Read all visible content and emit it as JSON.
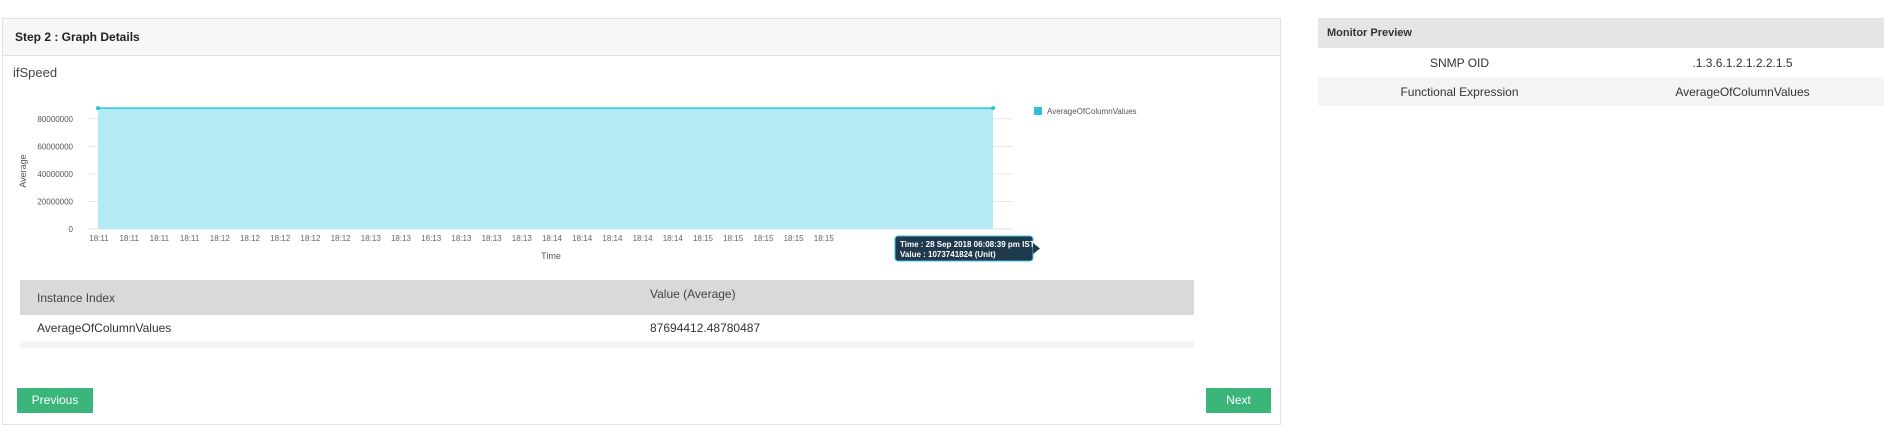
{
  "panel": {
    "title": "Step 2 : Graph Details"
  },
  "chart_data": {
    "type": "area",
    "title": "ifSpeed",
    "xlabel": "Time",
    "ylabel": "Average",
    "ylim": [
      0,
      90000000
    ],
    "yticks": [
      0,
      20000000,
      40000000,
      60000000,
      80000000
    ],
    "ytick_labels": [
      "0",
      "20000000",
      "40000000",
      "60000000",
      "80000000"
    ],
    "xtick_labels": [
      "18:11",
      "18:11",
      "18:11",
      "18:11",
      "18:12",
      "18:12",
      "18:12",
      "18:12",
      "18:12",
      "18:13",
      "18:13",
      "18:13",
      "18:13",
      "18:13",
      "18:13",
      "18:14",
      "18:14",
      "18:14",
      "18:14",
      "18:14",
      "18:15",
      "18:15",
      "18:15",
      "18:15",
      "18:15"
    ],
    "series": [
      {
        "name": "AverageOfColumnValues",
        "color": "#2ec0de",
        "fill": "#b3ebf5",
        "values": [
          87694412,
          87694412
        ]
      }
    ],
    "grid": true,
    "legend": "top-right",
    "tooltip": {
      "line1": "Time : 28 Sep 2018 06:08:39 pm IST",
      "line2": "Value : 1073741824 (Unit)"
    }
  },
  "table": {
    "headers": [
      "Instance Index",
      "Value (Average)"
    ],
    "rows": [
      [
        "AverageOfColumnValues",
        "87694412.48780487"
      ]
    ]
  },
  "buttons": {
    "previous": "Previous",
    "next": "Next"
  },
  "preview": {
    "title": "Monitor Preview",
    "rows": [
      {
        "key": "SNMP OID",
        "value": ".1.3.6.1.2.1.2.2.1.5"
      },
      {
        "key": "Functional Expression",
        "value": "AverageOfColumnValues"
      }
    ]
  },
  "colors": {
    "accent": "#3bb57a",
    "series": "#2ec0de",
    "tooltip_bg": "#1e3a4c"
  }
}
